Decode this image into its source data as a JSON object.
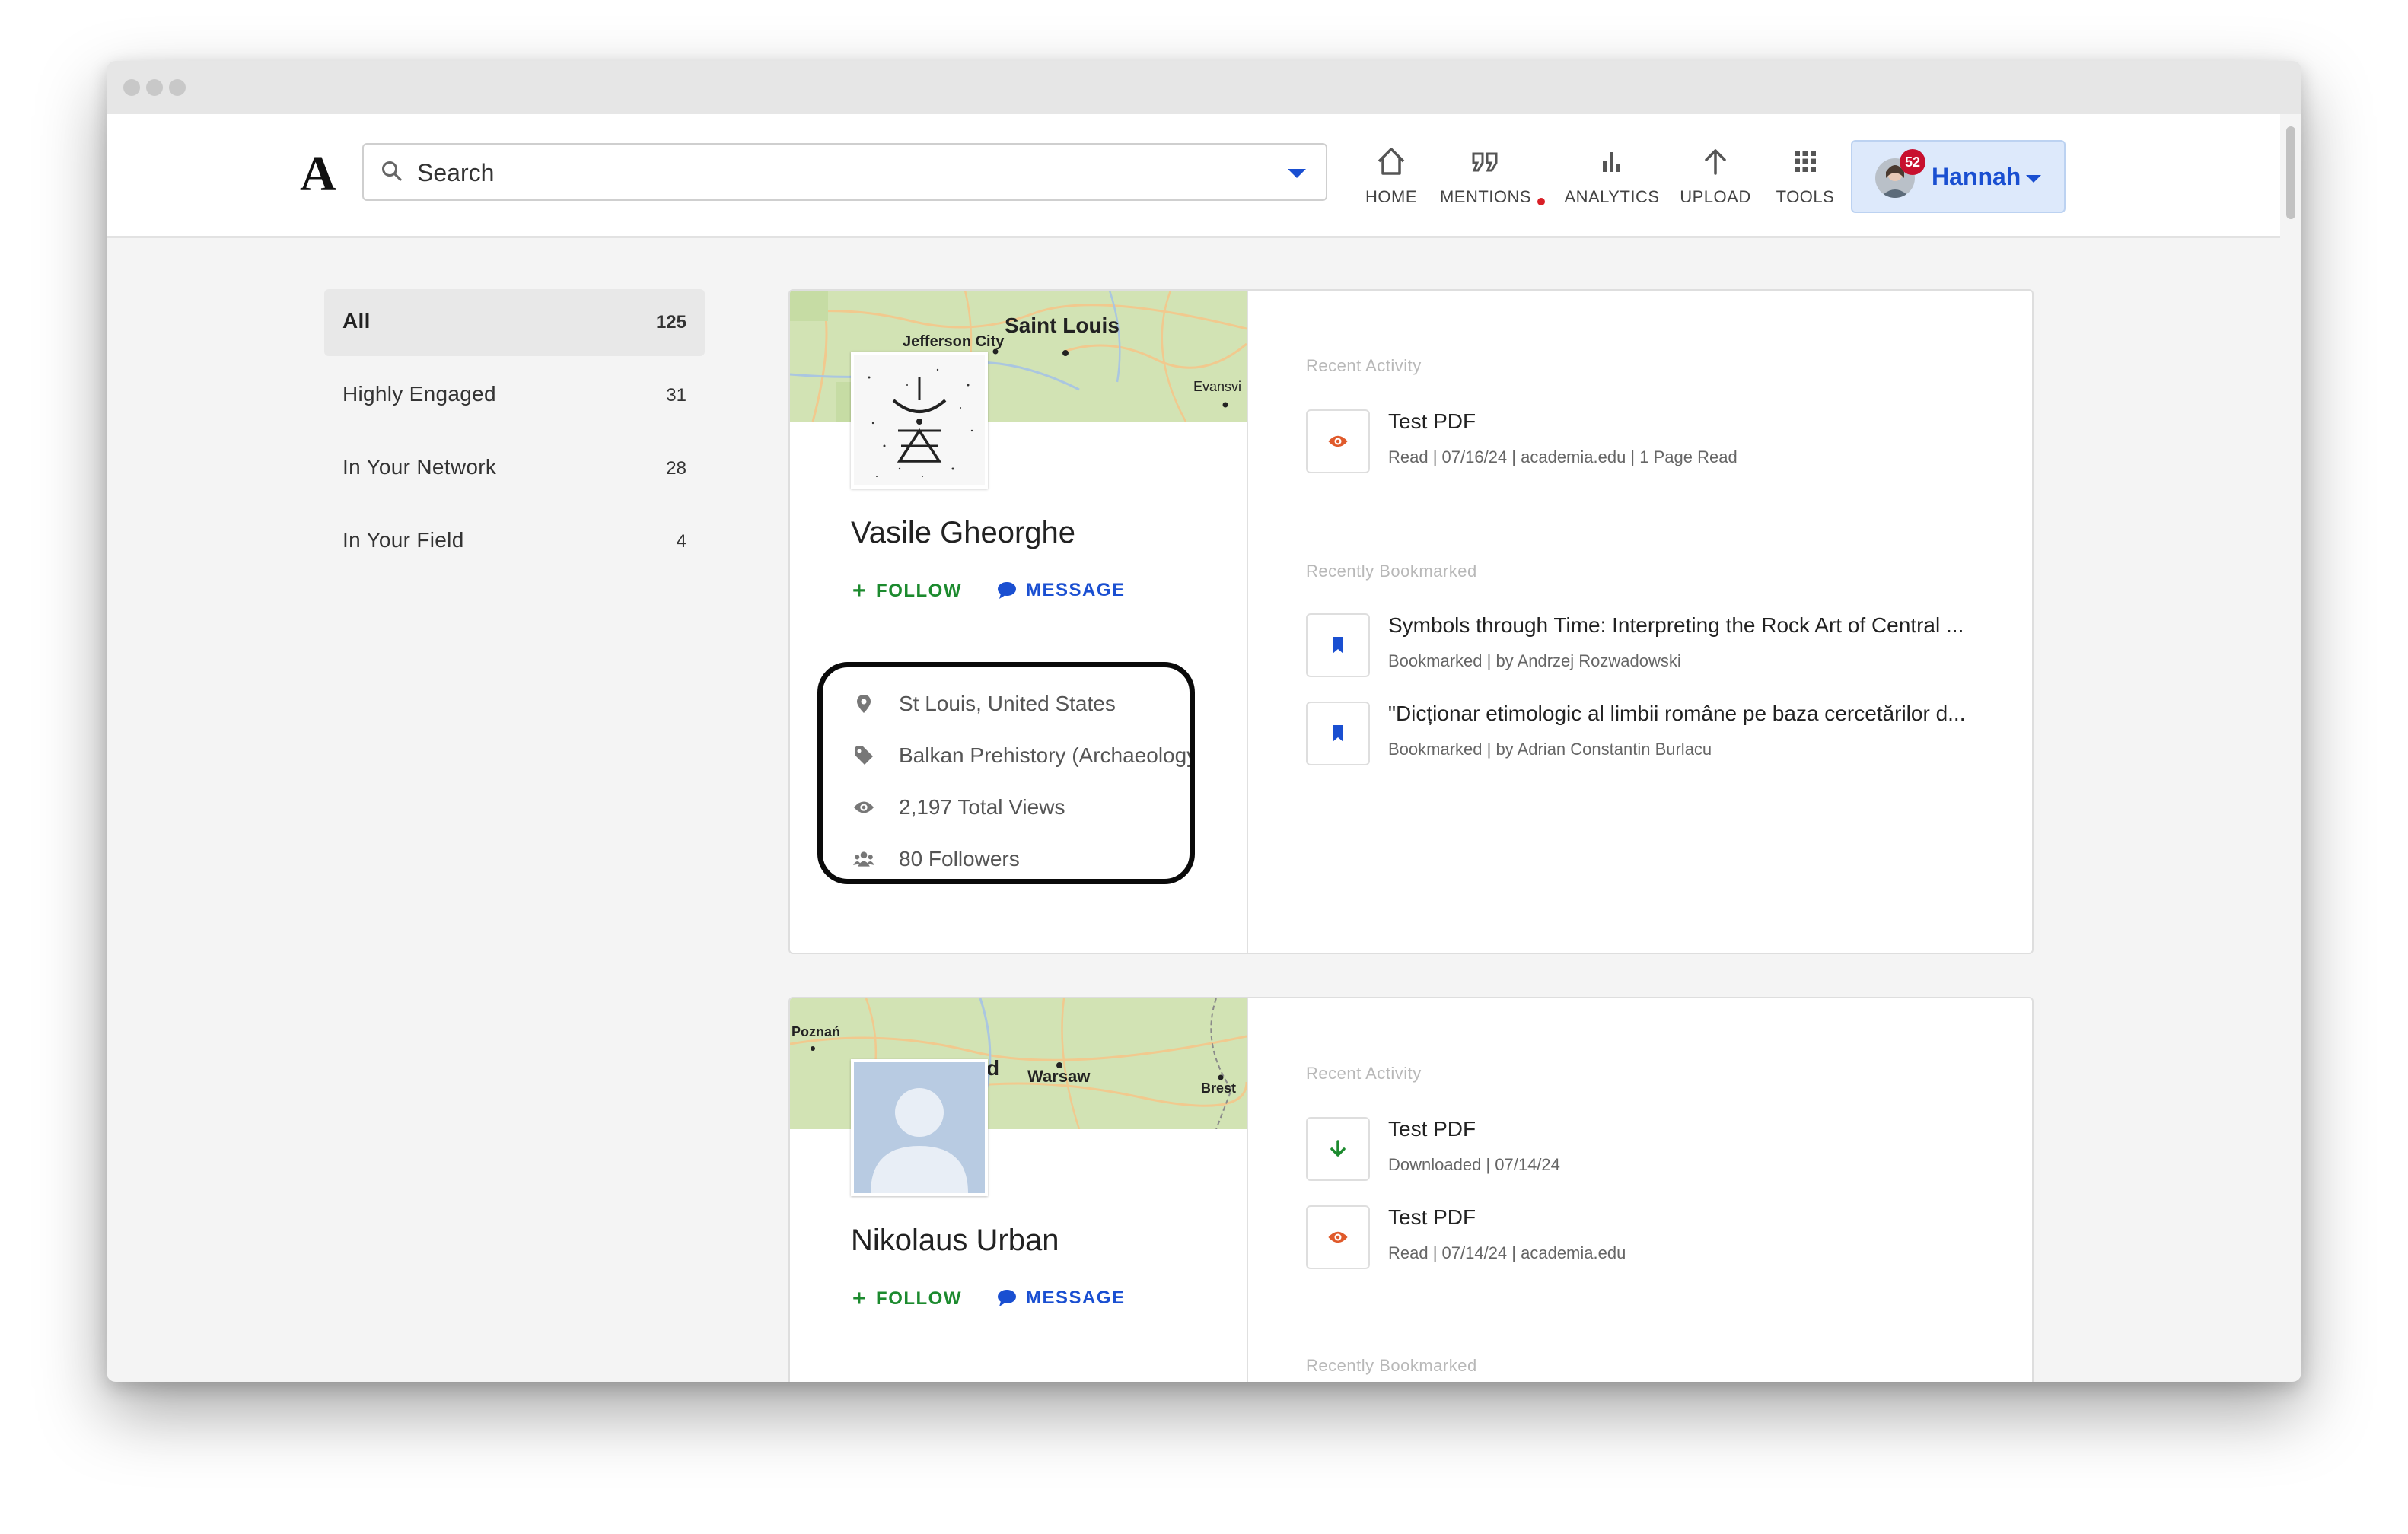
{
  "header": {
    "logo": "A",
    "search_placeholder": "Search",
    "nav": [
      {
        "label": "HOME",
        "icon": "home-icon"
      },
      {
        "label": "MENTIONS",
        "icon": "quote-icon"
      },
      {
        "label": "ANALYTICS",
        "icon": "bar-chart-icon"
      },
      {
        "label": "UPLOAD",
        "icon": "upload-arrow-icon"
      },
      {
        "label": "TOOLS",
        "icon": "grid-icon"
      }
    ],
    "user": {
      "name": "Hannah",
      "notification_count": "52"
    }
  },
  "filters": [
    {
      "label": "All",
      "count": "125"
    },
    {
      "label": "Highly Engaged",
      "count": "31"
    },
    {
      "label": "In Your Network",
      "count": "28"
    },
    {
      "label": "In Your Field",
      "count": "4"
    }
  ],
  "profiles": [
    {
      "name": "Vasile Gheorghe",
      "map_labels": [
        "Saint Louis",
        "Jefferson City",
        "Evansvi"
      ],
      "follow_label": "FOLLOW",
      "message_label": "MESSAGE",
      "location": "St Louis, United States",
      "field": "Balkan Prehistory (Archaeology)",
      "views": "2,197 Total Views",
      "followers": "80 Followers",
      "recent_activity_heading": "Recent Activity",
      "recent_activity": [
        {
          "title": "Test PDF",
          "meta": "Read  |  07/16/24  |  academia.edu  |  1 Page Read",
          "icon": "eye-icon"
        }
      ],
      "bookmarked_heading": "Recently Bookmarked",
      "bookmarked": [
        {
          "title": "Symbols through Time: Interpreting the Rock Art of Central ...",
          "meta": "Bookmarked  |  by Andrzej Rozwadowski",
          "icon": "bookmark-icon"
        },
        {
          "title": "\"Dicționar etimologic al limbii române pe baza cercetărilor d...",
          "meta": "Bookmarked  |  by Adrian Constantin Burlacu",
          "icon": "bookmark-icon"
        }
      ]
    },
    {
      "name": "Nikolaus Urban",
      "map_labels": [
        "Poznań",
        "Warsaw",
        "Brest",
        "d"
      ],
      "follow_label": "FOLLOW",
      "message_label": "MESSAGE",
      "recent_activity_heading": "Recent Activity",
      "recent_activity": [
        {
          "title": "Test PDF",
          "meta": "Downloaded  |  07/14/24",
          "icon": "download-arrow-icon"
        },
        {
          "title": "Test PDF",
          "meta": "Read  |  07/14/24  |  academia.edu",
          "icon": "eye-icon"
        }
      ],
      "bookmarked_heading": "Recently Bookmarked"
    }
  ],
  "colors": {
    "accent_blue": "#1a4fd1",
    "follow_green": "#1c8a2e",
    "read_orange": "#e05a2b",
    "badge_red": "#c8102e"
  }
}
